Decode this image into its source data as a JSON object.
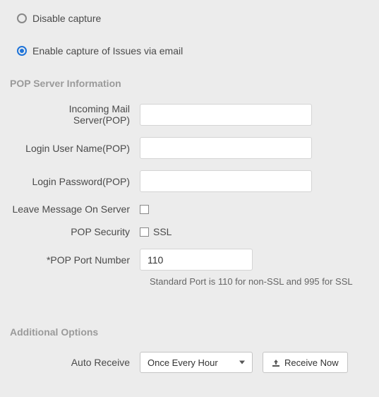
{
  "capture": {
    "disable_label": "Disable capture",
    "enable_label": "Enable capture of Issues via email",
    "selected": "enable"
  },
  "pop": {
    "section_title": "POP Server Information",
    "incoming_server_label": "Incoming Mail Server(POP)",
    "incoming_server_value": "",
    "login_user_label": "Login User Name(POP)",
    "login_user_value": "",
    "login_password_label": "Login Password(POP)",
    "login_password_value": "",
    "leave_on_server_label": "Leave Message On Server",
    "security_label": "POP Security",
    "ssl_label": "SSL",
    "port_label": "*POP Port Number",
    "port_value": "110",
    "port_help": "Standard Port is 110 for non-SSL and 995 for SSL"
  },
  "additional": {
    "section_title": "Additional Options",
    "auto_receive_label": "Auto Receive",
    "auto_receive_value": "Once Every Hour",
    "receive_now_label": "Receive Now"
  }
}
